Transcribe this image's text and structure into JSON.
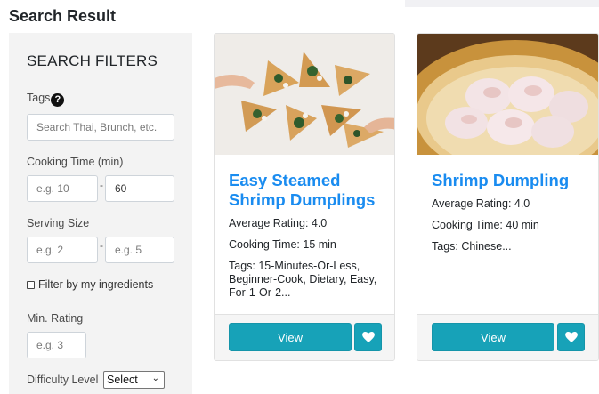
{
  "page_title": "Search Result",
  "filters": {
    "title": "SEARCH FILTERS",
    "tags_label": "Tags",
    "tags_placeholder": "Search Thai, Brunch, etc.",
    "cooking_time_label": "Cooking Time (min)",
    "cooking_time_min_placeholder": "e.g. 10",
    "cooking_time_max_value": "60",
    "serving_size_label": "Serving Size",
    "serving_min_placeholder": "e.g. 2",
    "serving_max_placeholder": "e.g. 5",
    "range_separator": "-",
    "ingredients_checkbox_label": "Filter by my ingredients",
    "ingredients_checked": false,
    "min_rating_label": "Min. Rating",
    "min_rating_placeholder": "e.g. 3",
    "difficulty_label": "Difficulty Level",
    "difficulty_selected": "Select"
  },
  "recipes": [
    {
      "title": "Easy Steamed Shrimp Dumplings",
      "rating": "Average Rating: 4.0",
      "cooking_time": "Cooking Time: 15 min",
      "tags": "Tags: 15-Minutes-Or-Less, Beginner-Cook, Dietary, Easy, For-1-Or-2...",
      "view_label": "View",
      "image": "pizza-slices-photo"
    },
    {
      "title": "Shrimp Dumpling",
      "rating": "Average Rating: 4.0",
      "cooking_time": "Cooking Time: 40 min",
      "tags": "Tags: Chinese...",
      "view_label": "View",
      "image": "dumplings-steamer-photo"
    }
  ],
  "colors": {
    "accent": "#17a2b8",
    "link": "#1a8cf0",
    "sidebar_bg": "#f3f3f3"
  }
}
